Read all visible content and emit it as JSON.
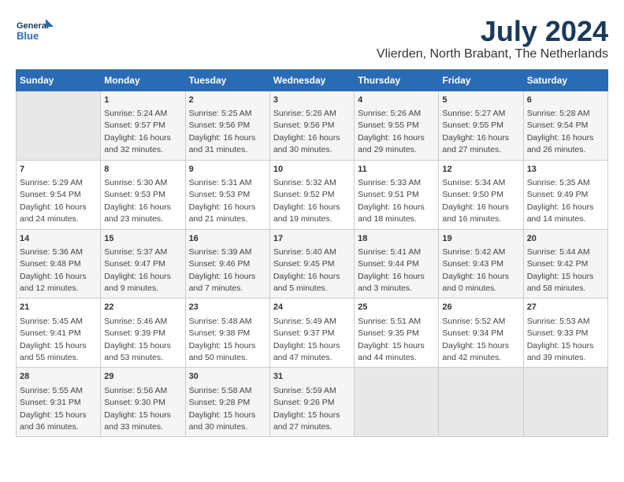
{
  "header": {
    "logo_line1": "General",
    "logo_line2": "Blue",
    "month": "July 2024",
    "location": "Vlierden, North Brabant, The Netherlands"
  },
  "days_of_week": [
    "Sunday",
    "Monday",
    "Tuesday",
    "Wednesday",
    "Thursday",
    "Friday",
    "Saturday"
  ],
  "weeks": [
    [
      {
        "day": "",
        "info": ""
      },
      {
        "day": "1",
        "info": "Sunrise: 5:24 AM\nSunset: 9:57 PM\nDaylight: 16 hours\nand 32 minutes."
      },
      {
        "day": "2",
        "info": "Sunrise: 5:25 AM\nSunset: 9:56 PM\nDaylight: 16 hours\nand 31 minutes."
      },
      {
        "day": "3",
        "info": "Sunrise: 5:26 AM\nSunset: 9:56 PM\nDaylight: 16 hours\nand 30 minutes."
      },
      {
        "day": "4",
        "info": "Sunrise: 5:26 AM\nSunset: 9:55 PM\nDaylight: 16 hours\nand 29 minutes."
      },
      {
        "day": "5",
        "info": "Sunrise: 5:27 AM\nSunset: 9:55 PM\nDaylight: 16 hours\nand 27 minutes."
      },
      {
        "day": "6",
        "info": "Sunrise: 5:28 AM\nSunset: 9:54 PM\nDaylight: 16 hours\nand 26 minutes."
      }
    ],
    [
      {
        "day": "7",
        "info": "Sunrise: 5:29 AM\nSunset: 9:54 PM\nDaylight: 16 hours\nand 24 minutes."
      },
      {
        "day": "8",
        "info": "Sunrise: 5:30 AM\nSunset: 9:53 PM\nDaylight: 16 hours\nand 23 minutes."
      },
      {
        "day": "9",
        "info": "Sunrise: 5:31 AM\nSunset: 9:53 PM\nDaylight: 16 hours\nand 21 minutes."
      },
      {
        "day": "10",
        "info": "Sunrise: 5:32 AM\nSunset: 9:52 PM\nDaylight: 16 hours\nand 19 minutes."
      },
      {
        "day": "11",
        "info": "Sunrise: 5:33 AM\nSunset: 9:51 PM\nDaylight: 16 hours\nand 18 minutes."
      },
      {
        "day": "12",
        "info": "Sunrise: 5:34 AM\nSunset: 9:50 PM\nDaylight: 16 hours\nand 16 minutes."
      },
      {
        "day": "13",
        "info": "Sunrise: 5:35 AM\nSunset: 9:49 PM\nDaylight: 16 hours\nand 14 minutes."
      }
    ],
    [
      {
        "day": "14",
        "info": "Sunrise: 5:36 AM\nSunset: 9:48 PM\nDaylight: 16 hours\nand 12 minutes."
      },
      {
        "day": "15",
        "info": "Sunrise: 5:37 AM\nSunset: 9:47 PM\nDaylight: 16 hours\nand 9 minutes."
      },
      {
        "day": "16",
        "info": "Sunrise: 5:39 AM\nSunset: 9:46 PM\nDaylight: 16 hours\nand 7 minutes."
      },
      {
        "day": "17",
        "info": "Sunrise: 5:40 AM\nSunset: 9:45 PM\nDaylight: 16 hours\nand 5 minutes."
      },
      {
        "day": "18",
        "info": "Sunrise: 5:41 AM\nSunset: 9:44 PM\nDaylight: 16 hours\nand 3 minutes."
      },
      {
        "day": "19",
        "info": "Sunrise: 5:42 AM\nSunset: 9:43 PM\nDaylight: 16 hours\nand 0 minutes."
      },
      {
        "day": "20",
        "info": "Sunrise: 5:44 AM\nSunset: 9:42 PM\nDaylight: 15 hours\nand 58 minutes."
      }
    ],
    [
      {
        "day": "21",
        "info": "Sunrise: 5:45 AM\nSunset: 9:41 PM\nDaylight: 15 hours\nand 55 minutes."
      },
      {
        "day": "22",
        "info": "Sunrise: 5:46 AM\nSunset: 9:39 PM\nDaylight: 15 hours\nand 53 minutes."
      },
      {
        "day": "23",
        "info": "Sunrise: 5:48 AM\nSunset: 9:38 PM\nDaylight: 15 hours\nand 50 minutes."
      },
      {
        "day": "24",
        "info": "Sunrise: 5:49 AM\nSunset: 9:37 PM\nDaylight: 15 hours\nand 47 minutes."
      },
      {
        "day": "25",
        "info": "Sunrise: 5:51 AM\nSunset: 9:35 PM\nDaylight: 15 hours\nand 44 minutes."
      },
      {
        "day": "26",
        "info": "Sunrise: 5:52 AM\nSunset: 9:34 PM\nDaylight: 15 hours\nand 42 minutes."
      },
      {
        "day": "27",
        "info": "Sunrise: 5:53 AM\nSunset: 9:33 PM\nDaylight: 15 hours\nand 39 minutes."
      }
    ],
    [
      {
        "day": "28",
        "info": "Sunrise: 5:55 AM\nSunset: 9:31 PM\nDaylight: 15 hours\nand 36 minutes."
      },
      {
        "day": "29",
        "info": "Sunrise: 5:56 AM\nSunset: 9:30 PM\nDaylight: 15 hours\nand 33 minutes."
      },
      {
        "day": "30",
        "info": "Sunrise: 5:58 AM\nSunset: 9:28 PM\nDaylight: 15 hours\nand 30 minutes."
      },
      {
        "day": "31",
        "info": "Sunrise: 5:59 AM\nSunset: 9:26 PM\nDaylight: 15 hours\nand 27 minutes."
      },
      {
        "day": "",
        "info": ""
      },
      {
        "day": "",
        "info": ""
      },
      {
        "day": "",
        "info": ""
      }
    ]
  ]
}
